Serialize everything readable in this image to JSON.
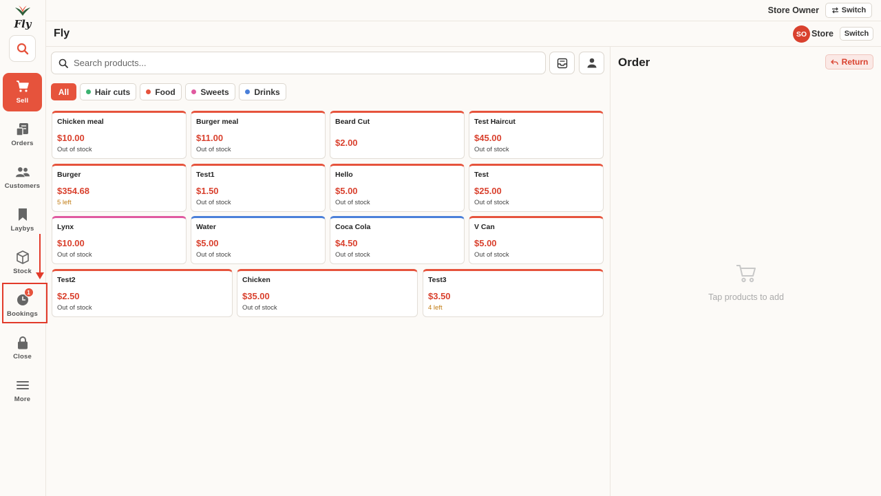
{
  "app": {
    "logo_text": "Fly",
    "store_title": "Fly"
  },
  "topbar": {
    "user_name": "Store Owner",
    "switch_label": "Switch"
  },
  "header": {
    "avatar_initials": "SO",
    "store_label": "Store",
    "switch_label": "Switch"
  },
  "sidebar": {
    "items": [
      {
        "label": "Sell",
        "icon": "cart-icon"
      },
      {
        "label": "Orders",
        "icon": "orders-icon"
      },
      {
        "label": "Customers",
        "icon": "customers-icon"
      },
      {
        "label": "Laybys",
        "icon": "bookmark-icon"
      },
      {
        "label": "Stock",
        "icon": "box-icon"
      },
      {
        "label": "Bookings",
        "icon": "clock-icon",
        "badge": "1"
      },
      {
        "label": "Close",
        "icon": "lock-icon"
      },
      {
        "label": "More",
        "icon": "menu-icon"
      }
    ]
  },
  "search": {
    "placeholder": "Search products..."
  },
  "categories": [
    {
      "label": "All",
      "active": true
    },
    {
      "label": "Hair cuts",
      "color": "#3cb371"
    },
    {
      "label": "Food",
      "color": "#e6533c"
    },
    {
      "label": "Sweets",
      "color": "#e05aa0"
    },
    {
      "label": "Drinks",
      "color": "#4a7fd9"
    }
  ],
  "products": [
    {
      "name": "Chicken meal",
      "price": "$10.00",
      "stock": "Out of stock"
    },
    {
      "name": "Burger meal",
      "price": "$11.00",
      "stock": "Out of stock"
    },
    {
      "name": "Beard Cut",
      "price": "$2.00",
      "stock": ""
    },
    {
      "name": "Test Haircut",
      "price": "$45.00",
      "stock": "Out of stock"
    },
    {
      "name": "Burger",
      "price": "$354.68",
      "stock": "5 left"
    },
    {
      "name": "Test1",
      "price": "$1.50",
      "stock": "Out of stock"
    },
    {
      "name": "Hello",
      "price": "$5.00",
      "stock": "Out of stock"
    },
    {
      "name": "Test",
      "price": "$25.00",
      "stock": "Out of stock"
    },
    {
      "name": "Lynx",
      "price": "$10.00",
      "stock": "Out of stock"
    },
    {
      "name": "Water",
      "price": "$5.00",
      "stock": "Out of stock"
    },
    {
      "name": "Coca Cola",
      "price": "$4.50",
      "stock": "Out of stock"
    },
    {
      "name": "V Can",
      "price": "$5.00",
      "stock": "Out of stock"
    },
    {
      "name": "Test2",
      "price": "$2.50",
      "stock": "Out of stock"
    },
    {
      "name": "Chicken",
      "price": "$35.00",
      "stock": "Out of stock"
    },
    {
      "name": "Test3",
      "price": "$3.50",
      "stock": "4 left"
    }
  ],
  "order": {
    "title": "Order",
    "return_label": "Return",
    "empty_text": "Tap products to add"
  },
  "colors": {
    "accent": "#e6533c",
    "annotation": "#e23a2a"
  }
}
